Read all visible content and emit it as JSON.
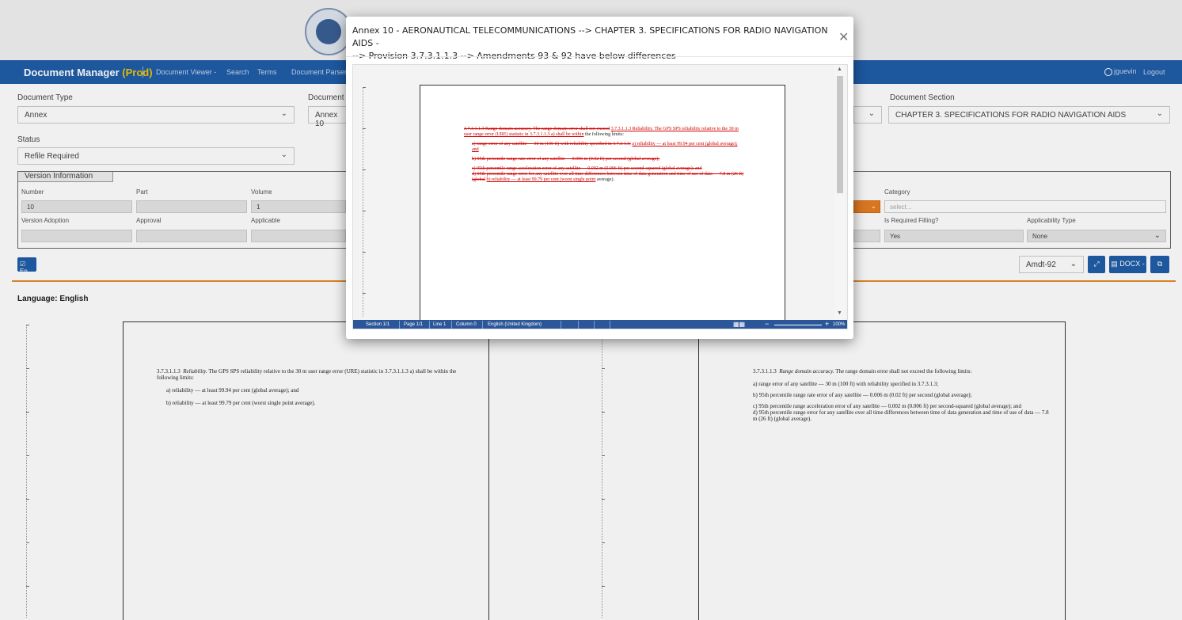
{
  "nav": {
    "brand": "Document Manager",
    "env": "(Prod)",
    "links": [
      "Document Viewer -",
      "Search",
      "Terms",
      "Document Parser"
    ],
    "user": "jguevin",
    "logout": "Logout"
  },
  "form": {
    "document_type_label": "Document Type",
    "document_type_value": "Annex",
    "document_label": "Document",
    "document_value": "Annex 10",
    "document_section_label": "Document Section",
    "document_section_value": "CHAPTER 3.   SPECIFICATIONS FOR RADIO NAVIGATION AIDS",
    "status_label": "Status",
    "status_value": "Refile Required"
  },
  "version": {
    "title": "Version Information",
    "number_label": "Number",
    "number_value": "10",
    "part_label": "Part",
    "volume_label": "Volume",
    "volume_value": "1",
    "version_adoption_label": "Version Adoption",
    "approval_label": "Approval",
    "applicable_label": "Applicable",
    "category_label": "Category",
    "category_placeholder": "select...",
    "required_filling_label": "Is Required Filling?",
    "required_filling_value": "Yes",
    "applicability_type_label": "Applicability Type",
    "applicability_type_value": "None"
  },
  "toolbar": {
    "lang_button": "En",
    "amendment": "Amdt-92",
    "docx_button": "DOCX -"
  },
  "language_label": "Language: English",
  "left_doc": {
    "para": "3.7.3.1.1.3",
    "para_title": "Reliability.",
    "intro": "The GPS SPS reliability relative to the 30 m user range error (URE) statistic in 3.7.3.1.1.3 a) shall be within the following limits:",
    "items": [
      "a)  reliability — at least 99.94 per cent (global average); and",
      "b)  reliability — at least 99.79 per cent (worst single point average)."
    ]
  },
  "right_doc": {
    "para": "3.7.3.1.1.3",
    "para_title": "Range domain accuracy.",
    "intro": "The range domain error shall not exceed the following limits:",
    "items": [
      "a)  range error of any satellite — 30 m (100 ft) with reliability specified in 3.7.3.1.3;",
      "b)  95th percentile range rate error of any satellite — 0.006 m (0.02 ft) per second (global average);",
      "c)  95th percentile range acceleration error of any satellite — 0.002 m (0.006 ft) per second-squared (global average); and",
      "d)  95th percentile range error for any satellite over all time differences between time of data generation and time of use of data — 7.8 m (26 ft) (global average)."
    ]
  },
  "modal": {
    "title_line1": "Annex 10 - AERONAUTICAL TELECOMMUNICATIONS --> CHAPTER 3.   SPECIFICATIONS FOR RADIO NAVIGATION AIDS -",
    "title_line2": "--> Provision 3.7.3.1.1.3 --> Amendments 93 & 92 have below differences",
    "diff": {
      "del_head": "3.7.3.1.1.3  Range domain accuracy. The range domain error shall not exceed",
      "ins_head": "3.7.3.1.1.3  Reliability. The GPS SPS reliability relative to the 30 m user range error (URE) statistic in 3.7.3.1.1.3 a) shall be within",
      "keep_head": "the following limits:",
      "del_a": "a)  range error of any satellite — 30 m (100 ft) with reliability specified in 3.7.3.1.3;",
      "ins_a": "a)  reliability — at least 99.94 per cent (global average); and",
      "del_b": "b)  95th percentile range rate error of any satellite — 0.006 m (0.02 ft) per second (global average);",
      "del_c": "c)  95th percentile range acceleration error of any satellite — 0.002 m (0.006 ft) per second-squared (global average); and",
      "del_d": "d)  95th percentile range error for any satellite over all time differences between time of data generation and time of use of data — 7.8 m (26 ft) (global",
      "ins_b": "b)  reliability — at least 99.79 per cent (worst single point",
      "keep_tail": "average)."
    },
    "status": {
      "section": "Section 1/1",
      "page": "Page 1/1",
      "line": "Line 1",
      "column": "Column 0",
      "language": "English (United Kingdom)",
      "zoom": "100%"
    }
  }
}
